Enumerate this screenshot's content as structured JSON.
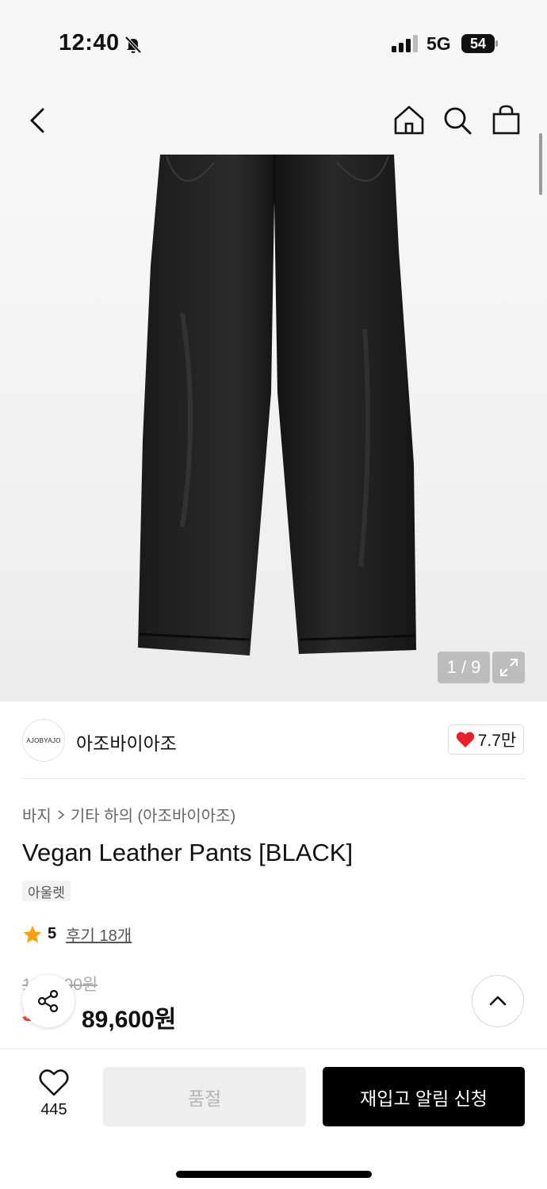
{
  "status_bar": {
    "time": "12:40",
    "network": "5G",
    "battery": "54"
  },
  "gallery": {
    "counter": "1 / 9"
  },
  "brand": {
    "logo_text": "AJOBYAJO",
    "name": "아조바이아조",
    "likes": "7.7만"
  },
  "breadcrumb": {
    "category": "바지",
    "subcategory": "기타 하의 (아조바이아조)"
  },
  "product": {
    "title": "Vegan Leather Pants [BLACK]",
    "tag": "아울렛",
    "rating": "5",
    "reviews_label": "후기 18개",
    "original_price": "128,000원",
    "discount": "30%",
    "sale_price": "89,600원"
  },
  "bottom_bar": {
    "wish_count": "445",
    "soldout_label": "품절",
    "restock_label": "재입고 알림 신청"
  },
  "colors": {
    "accent_red": "#ff3b30",
    "heart": "#e8202a",
    "star": "#ff9f0a",
    "primary_button": "#000000"
  }
}
